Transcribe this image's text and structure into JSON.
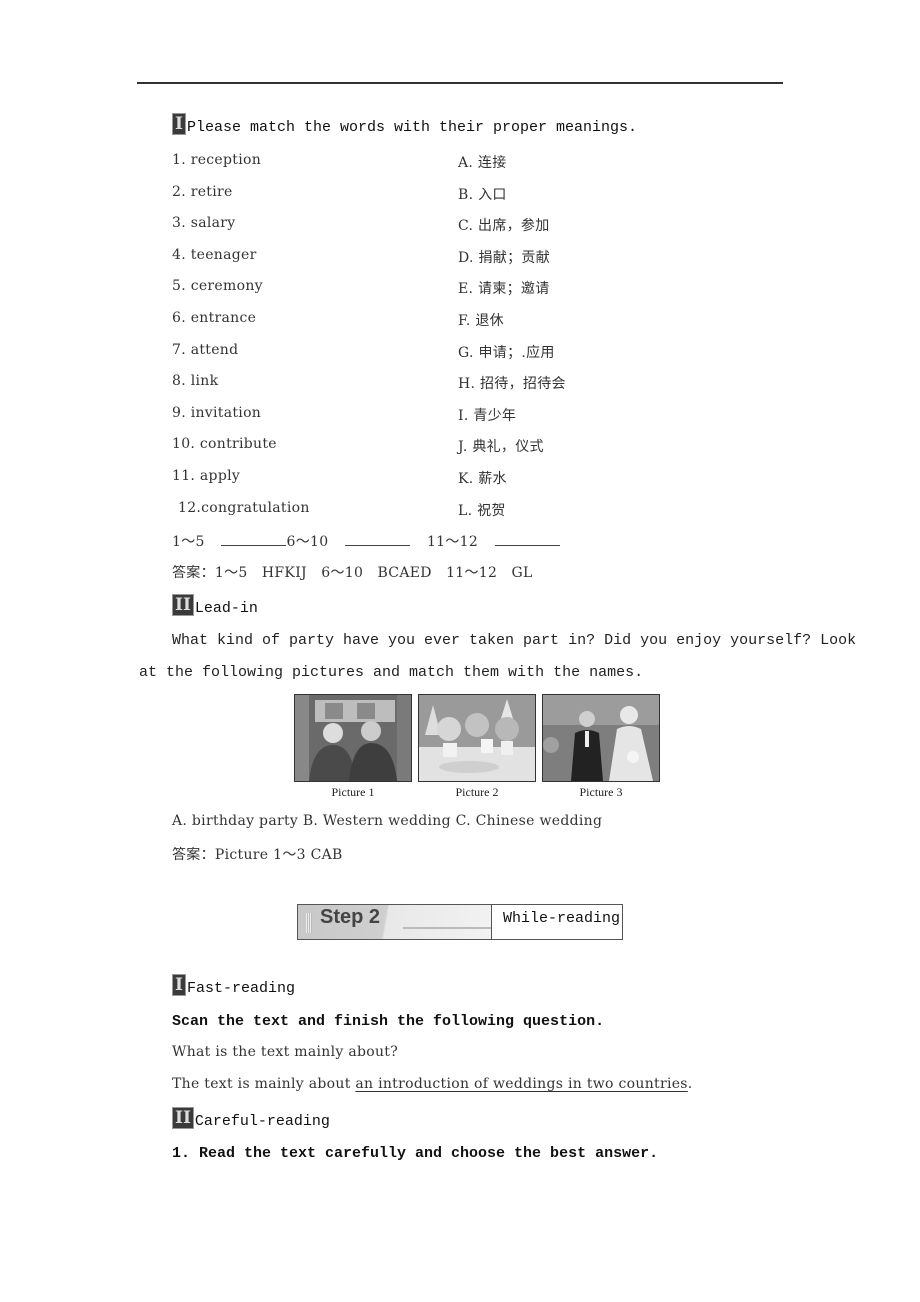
{
  "section1": {
    "numeral": "I",
    "title": "Please match the words with their proper meanings.",
    "words": [
      "1. reception",
      "2. retire",
      "3. salary",
      "4. teenager",
      "5. ceremony",
      "6. entrance",
      "7. attend",
      "8. link",
      "9. invitation",
      "10. contribute",
      "11. apply",
      "12.congratulation"
    ],
    "meanings": [
      "A. 连接",
      "B. 入口",
      "C. 出席，参加",
      "D. 捐献；贡献",
      "E. 请柬；邀请",
      "F. 退休",
      "G. 申请；.应用",
      "H. 招待，招待会",
      "I. 青少年",
      "J. 典礼，仪式",
      "K. 薪水",
      "L. 祝贺"
    ],
    "blank_groups": [
      "1～5",
      "6～10",
      "11～12"
    ],
    "answer": "答案：1～5　HFKIJ　6～10　BCAED　11～12　GL"
  },
  "section2": {
    "numeral": "II",
    "title": "Lead-in",
    "prompt_line1": "What kind of party have you ever taken part in?  Did you enjoy yourself?  Look",
    "prompt_line2": "at the following pictures and match them with the names.",
    "pictures": [
      {
        "caption": "Picture 1",
        "depicts": "Chinese wedding"
      },
      {
        "caption": "Picture 2",
        "depicts": "birthday party"
      },
      {
        "caption": "Picture 3",
        "depicts": "Western wedding"
      }
    ],
    "options": "A. birthday party  B. Western wedding  C. Chinese wedding",
    "answer": "答案：Picture 1～3  CAB"
  },
  "step": {
    "label": "Step 2",
    "name": "While-reading"
  },
  "fast_reading": {
    "numeral": "I",
    "title": "Fast-reading",
    "instruction": "Scan the text and finish the following question.",
    "question": "What is the text mainly about?",
    "answer_prefix": "The text is mainly about ",
    "answer_underlined": "an introduction of weddings in two countries",
    "answer_suffix": "."
  },
  "careful_reading": {
    "numeral": "II",
    "title": "Careful-reading",
    "instruction": "1. Read the text carefully and choose the best answer."
  }
}
